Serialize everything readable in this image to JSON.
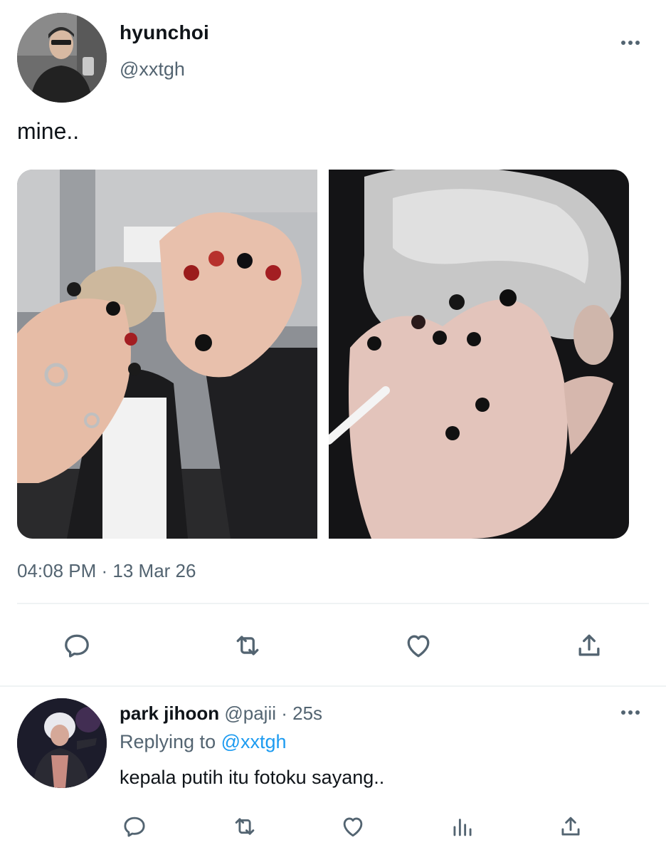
{
  "tweet": {
    "author_name": "hyunchoi",
    "author_handle": "@xxtgh",
    "text": "mine..",
    "timestamp": "04:08 PM · 13 Mar 26",
    "media": [
      {
        "alt": "hands with painted nails in front of a shop"
      },
      {
        "alt": "hands with black painted nails covering face"
      }
    ],
    "actions": [
      {
        "icon": "reply-icon"
      },
      {
        "icon": "retweet-icon"
      },
      {
        "icon": "like-icon"
      },
      {
        "icon": "share-icon"
      }
    ]
  },
  "reply": {
    "author_name": "park jihoon",
    "author_handle": "@pajii",
    "separator": " · ",
    "time": "25s",
    "replying_prefix": "Replying to",
    "replying_to": "@xxtgh",
    "text": "kepala putih itu fotoku sayang..",
    "actions": [
      {
        "icon": "reply-icon"
      },
      {
        "icon": "retweet-icon"
      },
      {
        "icon": "like-icon"
      },
      {
        "icon": "analytics-icon"
      },
      {
        "icon": "share-icon"
      }
    ]
  },
  "colors": {
    "text_primary": "#0f1419",
    "text_secondary": "#536471",
    "accent": "#1d9bf0",
    "divider": "#eff3f4"
  }
}
